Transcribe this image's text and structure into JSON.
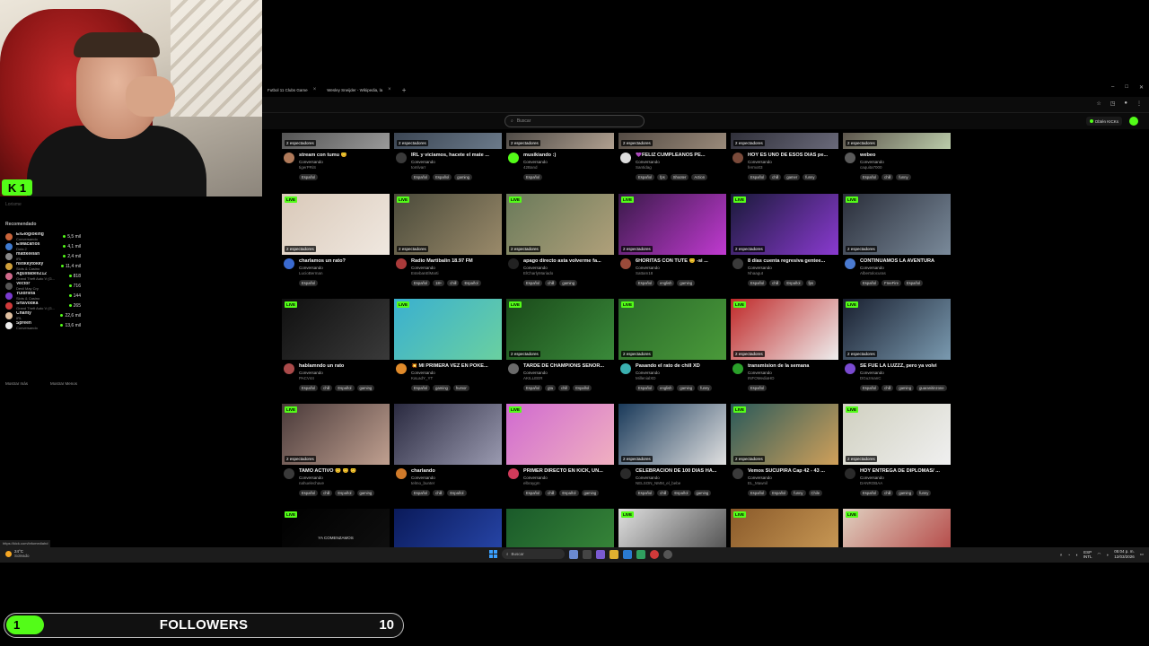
{
  "webcam": {
    "badge": "K 1",
    "user_label": "Lorisme"
  },
  "browser": {
    "tabs": [
      {
        "label": "Futbol 11 Clubs Game"
      },
      {
        "label": "Wesley Sneijder - Wikipedia, la"
      }
    ],
    "add_tab": "+",
    "window_controls": [
      "–",
      "□",
      "✕"
    ]
  },
  "header": {
    "search_placeholder": "Buscar",
    "get_kicks": "Obtén KICKs"
  },
  "sidebar": {
    "title": "Recomendado",
    "items": [
      {
        "name": "ElGlogloking",
        "category": "Conversando",
        "viewers": "5,5 mil",
        "color": "#c9643a"
      },
      {
        "name": "ElMacarios",
        "category": "Dota 2",
        "viewers": "4,1 mil",
        "color": "#3f7bd1"
      },
      {
        "name": "mattkeelan",
        "category": "IRL",
        "viewers": "2,4 mil",
        "color": "#888888"
      },
      {
        "name": "hstikkytokky",
        "category": "Slots & Casino",
        "viewers": "11,4 mil",
        "color": "#d0a03a"
      },
      {
        "name": "Agustabell212",
        "category": "Grand Theft Auto V (G...",
        "viewers": "818",
        "color": "#d06a8c"
      },
      {
        "name": "Vector",
        "category": "Devil May Cry",
        "viewers": "716",
        "color": "#555555"
      },
      {
        "name": "Yuldrieta",
        "category": "Slots & Casino",
        "viewers": "144",
        "color": "#7a3ad0"
      },
      {
        "name": "SrtaVodka",
        "category": "Grand Theft Auto V (G...",
        "viewers": "265",
        "color": "#d03a3a"
      },
      {
        "name": "Chanty",
        "category": "IRL",
        "viewers": "22,6 mil",
        "color": "#e0c0a0"
      },
      {
        "name": "Spreen",
        "category": "Conversando",
        "viewers": "13,6 mil",
        "color": "#eeeeee"
      }
    ],
    "show_more": "Mostrar más",
    "show_less": "Mostrar Menos"
  },
  "live_label": "LIVE",
  "streams": [
    {
      "title": "",
      "category": "",
      "user": "",
      "tags": [],
      "spectators": "2 espectadores",
      "thumb": [
        "#1c1c1c",
        "#e8e8e8"
      ],
      "avatar": "#444",
      "live": false
    },
    {
      "title": "stream con tumu 😊",
      "category": "Conversando",
      "user": "tigerPRiS",
      "tags": [
        "Español"
      ],
      "spectators": "2 espectadores",
      "thumb": [
        "#3a3a3a",
        "#9a9a9a"
      ],
      "avatar": "#b07a5a",
      "live": false
    },
    {
      "title": "IRL y viciamos, hacete el mate ...",
      "category": "Conversando",
      "user": "tomlvarr",
      "tags": [
        "Español",
        "Español",
        "gaming"
      ],
      "spectators": "2 espectadores",
      "thumb": [
        "#2a3340",
        "#6b7a8a"
      ],
      "avatar": "#3a3a3a",
      "live": false
    },
    {
      "title": "musikiando :)",
      "category": "Conversando",
      "user": "42Band",
      "tags": [
        "Español"
      ],
      "spectators": "2 espectadores",
      "thumb": [
        "#2c2c2c",
        "#b0a090"
      ],
      "avatar": "#53fc18",
      "live": false
    },
    {
      "title": "💜FELIZ CUMPLEAÑOS PE...",
      "category": "Conversando",
      "user": "Santidag",
      "tags": [
        "Español",
        "fps",
        "Shooter",
        "Action"
      ],
      "spectators": "2 espectadores",
      "thumb": [
        "#3a3430",
        "#9a8a7a"
      ],
      "avatar": "#dddddd",
      "live": false
    },
    {
      "title": "HOY ES UNO DE ESOS DÍAS pe...",
      "category": "Conversando",
      "user": "fermo03",
      "tags": [
        "Español",
        "chill",
        "gamer",
        "funny"
      ],
      "spectators": "2 espectadores",
      "thumb": [
        "#1a1a22",
        "#6a6a7a"
      ],
      "avatar": "#7a4a3a",
      "live": false
    },
    {
      "title": "webeo",
      "category": "Conversando",
      "user": "caquita7000",
      "tags": [
        "Español",
        "chill",
        "funny"
      ],
      "spectators": "2 espectadores",
      "thumb": [
        "#3a2a2a",
        "#bca"
      ],
      "avatar": "#5a5a5a",
      "live": false
    },
    {
      "title": "charlamos un rato?",
      "category": "Conversando",
      "user": "LucioBerman",
      "tags": [
        "Español"
      ],
      "spectators": "2 espectadores",
      "thumb": [
        "#d9c9b9",
        "#f0e8e0"
      ],
      "avatar": "#3a6ad0",
      "live": true
    },
    {
      "title": "Radio Martibalin 18.97 FM",
      "category": "Conversando",
      "user": "EstebanElMarti",
      "tags": [
        "Español",
        "18+",
        "chill",
        "Español"
      ],
      "spectators": "2 espectadores",
      "thumb": [
        "#4a4a3a",
        "#9a8a6a"
      ],
      "avatar": "#aa3a3a",
      "live": true
    },
    {
      "title": "apago directo asta volverme fa...",
      "category": "Conversando",
      "user": "ElCharlyMariado",
      "tags": [
        "Español",
        "chill",
        "gaming"
      ],
      "spectators": "2 espectadores",
      "thumb": [
        "#6a7a5a",
        "#b0a07a"
      ],
      "avatar": "#222",
      "live": true
    },
    {
      "title": "6HORITAS CON TUTE 😊 -si ...",
      "category": "Conversando",
      "user": "Sattam18",
      "tags": [
        "Español",
        "english",
        "gaming"
      ],
      "spectators": "2 espectadores",
      "thumb": [
        "#3a1a4a",
        "#c03ad0"
      ],
      "avatar": "#9a4a3a",
      "live": true
    },
    {
      "title": "8 días cuenta regresiva gentee...",
      "category": "Conversando",
      "user": "Nhaagut",
      "tags": [
        "Español",
        "chill",
        "Español",
        "fps"
      ],
      "spectators": "2 espectadores",
      "thumb": [
        "#1a1a3a",
        "#8a3ad0"
      ],
      "avatar": "#3a3a3a",
      "live": true
    },
    {
      "title": "CONTINUAMOS LA AVENTURA",
      "category": "Conversando",
      "user": "Albertolocuras",
      "tags": [
        "Español",
        "FreeFire",
        "Español"
      ],
      "spectators": "2 espectadores",
      "thumb": [
        "#2a2e3a",
        "#7a8a9a"
      ],
      "avatar": "#4a7ad0",
      "live": true
    },
    {
      "title": "hablamndo un rato",
      "category": "Conversando",
      "user": "PACV44",
      "tags": [
        "Español",
        "chill",
        "Español",
        "gaming"
      ],
      "spectators": "",
      "thumb": [
        "#101010",
        "#3a3a3a"
      ],
      "avatar": "#aa4a4a",
      "live": true
    },
    {
      "title": "💥 MI PRIMERA VEZ EN POKE...",
      "category": "Conversando",
      "user": "KaLadY_YT",
      "tags": [
        "Español",
        "gaming",
        "humor"
      ],
      "spectators": "",
      "thumb": [
        "#3ab0d0",
        "#6ad0a0"
      ],
      "avatar": "#e08a2a",
      "live": true
    },
    {
      "title": "TARDE DE CHAMPIONS SEÑOR...",
      "category": "Conversando",
      "user": "AKILLEER",
      "tags": [
        "Español",
        "gta",
        "chill",
        "Español"
      ],
      "spectators": "2 espectadores",
      "thumb": [
        "#1a4a1a",
        "#3a8a3a"
      ],
      "avatar": "#6a6a6a",
      "live": true
    },
    {
      "title": "Pasando el rato de chill XD",
      "category": "Conversando",
      "user": "MillenialXD",
      "tags": [
        "Español",
        "english",
        "gaming",
        "funny"
      ],
      "spectators": "2 espectadores",
      "thumb": [
        "#2a6a2a",
        "#4a9a3a"
      ],
      "avatar": "#3ab0b0",
      "live": true
    },
    {
      "title": "transmision de la semana",
      "category": "Conversando",
      "user": "INFOMediaHD",
      "tags": [
        "Español"
      ],
      "spectators": "2 espectadores",
      "thumb": [
        "#c02a2a",
        "#eeeeee"
      ],
      "avatar": "#2aa02a",
      "live": true
    },
    {
      "title": "SE FUE LA LUZZZ, pero ya volvi",
      "category": "Conversando",
      "user": "DGuzmanC",
      "tags": [
        "Español",
        "chill",
        "gaming",
        "guaranitinzone"
      ],
      "spectators": "2 espectadores",
      "thumb": [
        "#1a2030",
        "#7a9ab0"
      ],
      "avatar": "#7a4ad0",
      "live": true
    },
    {
      "title": "TAMO ACTIVO 😊 😊 😊",
      "category": "Conversando",
      "user": "nahuelechave",
      "tags": [
        "Español",
        "chill",
        "Español",
        "gaming"
      ],
      "spectators": "2 espectadores",
      "thumb": [
        "#4a3a3a",
        "#c0a090"
      ],
      "avatar": "#3a3a3a",
      "live": true
    },
    {
      "title": "charlando",
      "category": "Conversando",
      "user": "telmo_bunter",
      "tags": [
        "Español",
        "chill",
        "Español"
      ],
      "spectators": "",
      "thumb": [
        "#2a2a40",
        "#9a9ab0"
      ],
      "avatar": "#d07a2a",
      "live": false
    },
    {
      "title": "PRIMER DIRECTO EN KICK, UN...",
      "category": "Conversando",
      "user": "elbraygm",
      "tags": [
        "Español",
        "chill",
        "Español",
        "gaming"
      ],
      "spectators": "",
      "thumb": [
        "#d06ad0",
        "#f0b0c0"
      ],
      "avatar": "#d03a5a",
      "live": true
    },
    {
      "title": "CELEBRACION DE 100 DIAS HA...",
      "category": "Conversando",
      "user": "NELSON_NMM_el_bebe",
      "tags": [
        "Español",
        "chill",
        "Español",
        "gaming"
      ],
      "spectators": "2 espectadores",
      "thumb": [
        "#1a3a5a",
        "#e0e0e0"
      ],
      "avatar": "#2a2a2a",
      "live": false
    },
    {
      "title": "Vemos SUCUPIRA Cap 42 - 43 ...",
      "category": "Conversando",
      "user": "EL_Mawnil",
      "tags": [
        "Español",
        "Español",
        "funny",
        "Chile"
      ],
      "spectators": "2 espectadores",
      "thumb": [
        "#2a5a5a",
        "#d0a05a"
      ],
      "avatar": "#3a3a3a",
      "live": true
    },
    {
      "title": "HOY ENTREGA DE DIPLOMAS/ ...",
      "category": "Conversando",
      "user": "DANROBAA",
      "tags": [
        "Español",
        "chill",
        "gaming",
        "funny"
      ],
      "spectators": "2 espectadores",
      "thumb": [
        "#d0d0c0",
        "#f0f0f0"
      ],
      "avatar": "#2a2a2a",
      "live": true
    },
    {
      "title": "",
      "category": "",
      "user": "",
      "tags": [],
      "spectators": "",
      "thumb": [
        "#000000",
        "#111111"
      ],
      "avatar": "#000",
      "live": true,
      "overlay": "YA COMENZAMOS"
    },
    {
      "title": "",
      "category": "",
      "user": "",
      "tags": [],
      "spectators": "",
      "thumb": [
        "#0a1a5a",
        "#2a4ab0"
      ],
      "avatar": "#000",
      "live": false
    },
    {
      "title": "",
      "category": "",
      "user": "",
      "tags": [],
      "spectators": "",
      "thumb": [
        "#1a5a2a",
        "#3a8a3a"
      ],
      "avatar": "#000",
      "live": false
    },
    {
      "title": "",
      "category": "",
      "user": "",
      "tags": [],
      "spectators": "",
      "thumb": [
        "#e0e0e0",
        "#404040"
      ],
      "avatar": "#000",
      "live": true
    },
    {
      "title": "",
      "category": "",
      "user": "",
      "tags": [],
      "spectators": "",
      "thumb": [
        "#8a5a2a",
        "#d0a05a"
      ],
      "avatar": "#000",
      "live": true
    },
    {
      "title": "",
      "category": "",
      "user": "",
      "tags": [],
      "spectators": "",
      "thumb": [
        "#e0d0c0",
        "#b03a3a"
      ],
      "avatar": "#000",
      "live": true
    }
  ],
  "status_url": "https://kick.com/infomediahd",
  "taskbar": {
    "weather_temp": "24°C",
    "weather_desc": "Soleado",
    "search": "Buscar",
    "lang": "ESP",
    "lang2": "INTL",
    "time": "05:04 p. m.",
    "date": "12/03/2026"
  },
  "followers": {
    "current": "1",
    "label": "FOLLOWERS",
    "goal": "10",
    "progress": 0.1
  }
}
